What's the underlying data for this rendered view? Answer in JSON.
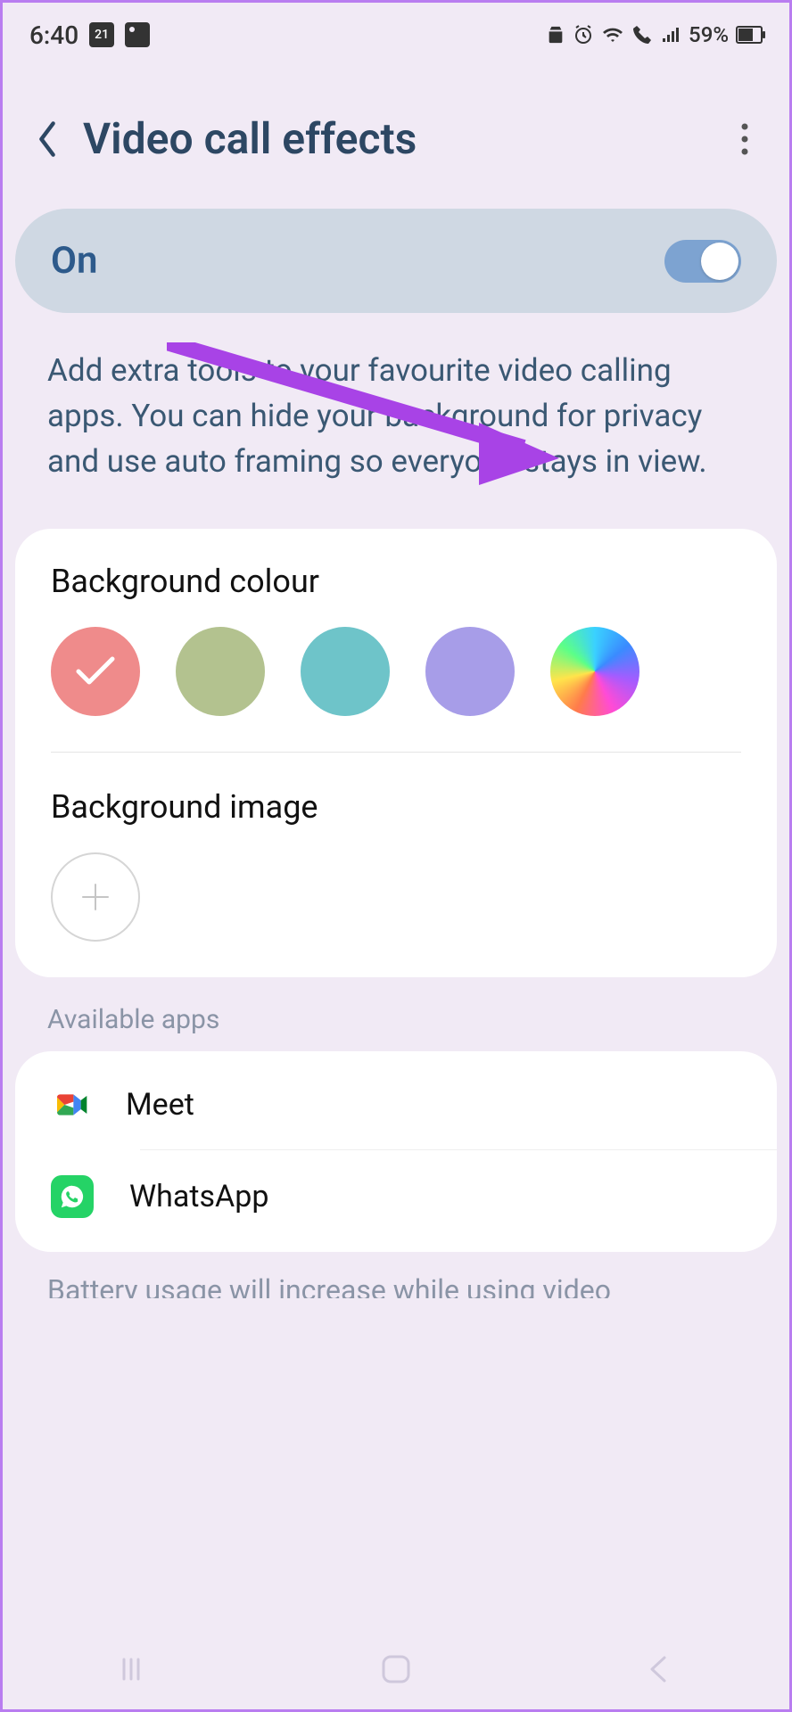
{
  "status": {
    "time": "6:40",
    "calendar_day": "21",
    "battery_pct": "59%"
  },
  "header": {
    "title": "Video call effects"
  },
  "toggle": {
    "label": "On",
    "state": true
  },
  "description": "Add extra tools to your favourite video calling apps. You can hide your background for privacy and use auto framing so everyone stays in view.",
  "background_colour": {
    "title": "Background colour",
    "swatches": [
      {
        "color": "#ef8b8b",
        "selected": true,
        "name": "pink"
      },
      {
        "color": "#b3c28f",
        "selected": false,
        "name": "sage"
      },
      {
        "color": "#6ec4c9",
        "selected": false,
        "name": "teal"
      },
      {
        "color": "#a79de8",
        "selected": false,
        "name": "lavender"
      },
      {
        "color": "rainbow",
        "selected": false,
        "name": "rainbow"
      }
    ]
  },
  "background_image": {
    "title": "Background image"
  },
  "available_apps": {
    "title": "Available apps",
    "items": [
      {
        "name": "Meet",
        "icon": "google-meet"
      },
      {
        "name": "WhatsApp",
        "icon": "whatsapp"
      }
    ]
  },
  "cutoff_text": "Battery usage will increase while using video",
  "annotation": {
    "arrow_color": "#a843e6"
  }
}
